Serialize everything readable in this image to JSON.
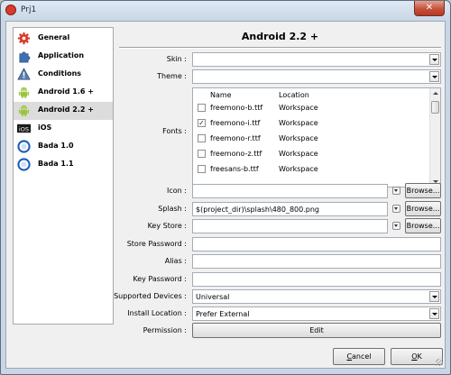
{
  "window": {
    "title": "Prj1",
    "close_label": "✕"
  },
  "sidebar": {
    "items": [
      {
        "label": "General",
        "icon": "gear-icon",
        "selected": false
      },
      {
        "label": "Application",
        "icon": "puzzle-icon",
        "selected": false
      },
      {
        "label": "Conditions",
        "icon": "warning-icon",
        "selected": false
      },
      {
        "label": "Android 1.6 +",
        "icon": "android-icon",
        "selected": false
      },
      {
        "label": "Android 2.2 +",
        "icon": "android-icon",
        "selected": true
      },
      {
        "label": "iOS",
        "icon": "ios-icon",
        "selected": false
      },
      {
        "label": "Bada 1.0",
        "icon": "bada-icon",
        "selected": false
      },
      {
        "label": "Bada 1.1",
        "icon": "bada-icon",
        "selected": false
      }
    ]
  },
  "main": {
    "heading": "Android 2.2 +",
    "skin": {
      "label": "Skin :",
      "value": ""
    },
    "theme": {
      "label": "Theme :",
      "value": ""
    },
    "fonts": {
      "label": "Fonts :",
      "columns": [
        "Name",
        "Location"
      ],
      "rows": [
        {
          "name": "freemono-b.ttf",
          "location": "Workspace",
          "checked": false
        },
        {
          "name": "freemono-i.ttf",
          "location": "Workspace",
          "checked": true
        },
        {
          "name": "freemono-r.ttf",
          "location": "Workspace",
          "checked": false
        },
        {
          "name": "freemono-z.ttf",
          "location": "Workspace",
          "checked": false
        },
        {
          "name": "freesans-b.ttf",
          "location": "Workspace",
          "checked": false
        }
      ]
    },
    "icon": {
      "label": "Icon :",
      "value": "",
      "browse": "Browse..."
    },
    "splash": {
      "label": "Splash :",
      "value": "$(project_dir)\\splash\\480_800.png",
      "browse": "Browse..."
    },
    "key_store": {
      "label": "Key Store :",
      "value": "",
      "browse": "Browse..."
    },
    "store_password": {
      "label": "Store Password :",
      "value": ""
    },
    "alias": {
      "label": "Alias :",
      "value": ""
    },
    "key_password": {
      "label": "Key Password :",
      "value": ""
    },
    "supported_devices": {
      "label": "Supported Devices :",
      "value": "Universal"
    },
    "install_location": {
      "label": "Install Location :",
      "value": "Prefer External"
    },
    "permission": {
      "label": "Permission :",
      "button": "Edit"
    }
  },
  "footer": {
    "cancel_rest": "ancel",
    "cancel_key": "C",
    "ok_key": "O",
    "ok_rest": "K"
  },
  "colors": {
    "android": "#9bc53d",
    "bada": "#1e5fb4",
    "gear": "#d93a2b",
    "selected_bg": "#dcdcdc"
  }
}
